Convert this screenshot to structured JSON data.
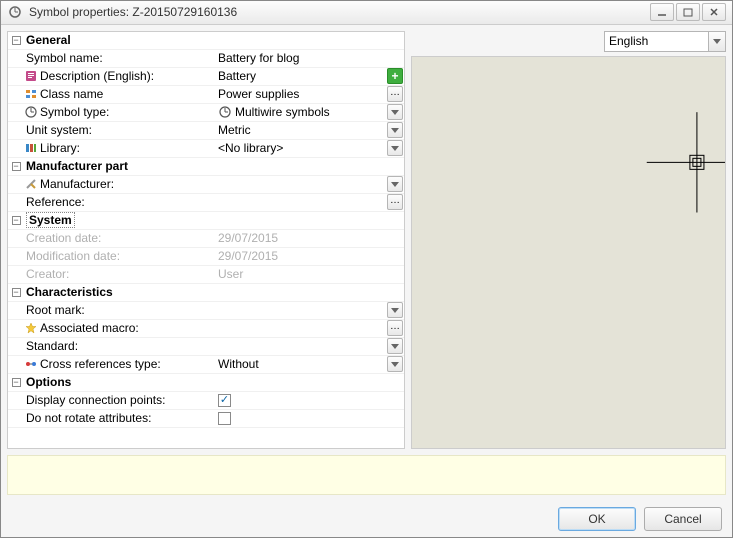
{
  "titlebar": {
    "title": "Symbol properties: Z-20150729160136"
  },
  "language": {
    "selected": "English"
  },
  "sections": {
    "general": {
      "header": "General",
      "symbol_name_label": "Symbol name:",
      "symbol_name_value": "Battery for blog",
      "description_label": "Description (English):",
      "description_value": "Battery",
      "class_name_label": "Class name",
      "class_name_value": "Power supplies",
      "symbol_type_label": "Symbol type:",
      "symbol_type_value": "Multiwire symbols",
      "unit_system_label": "Unit system:",
      "unit_system_value": "Metric",
      "library_label": "Library:",
      "library_value": "<No library>"
    },
    "manufacturer": {
      "header": "Manufacturer part",
      "manufacturer_label": "Manufacturer:",
      "manufacturer_value": "",
      "reference_label": "Reference:",
      "reference_value": ""
    },
    "system": {
      "header": "System",
      "creation_date_label": "Creation date:",
      "creation_date_value": "29/07/2015",
      "modification_date_label": "Modification date:",
      "modification_date_value": "29/07/2015",
      "creator_label": "Creator:",
      "creator_value": "User"
    },
    "characteristics": {
      "header": "Characteristics",
      "root_mark_label": "Root mark:",
      "root_mark_value": "",
      "associated_macro_label": "Associated macro:",
      "associated_macro_value": "",
      "standard_label": "Standard:",
      "standard_value": "",
      "cross_ref_label": "Cross references type:",
      "cross_ref_value": "Without"
    },
    "options": {
      "header": "Options",
      "display_cp_label": "Display connection points:",
      "display_cp_checked": true,
      "do_not_rotate_label": "Do not rotate attributes:",
      "do_not_rotate_checked": false
    }
  },
  "buttons": {
    "ok": "OK",
    "cancel": "Cancel"
  }
}
